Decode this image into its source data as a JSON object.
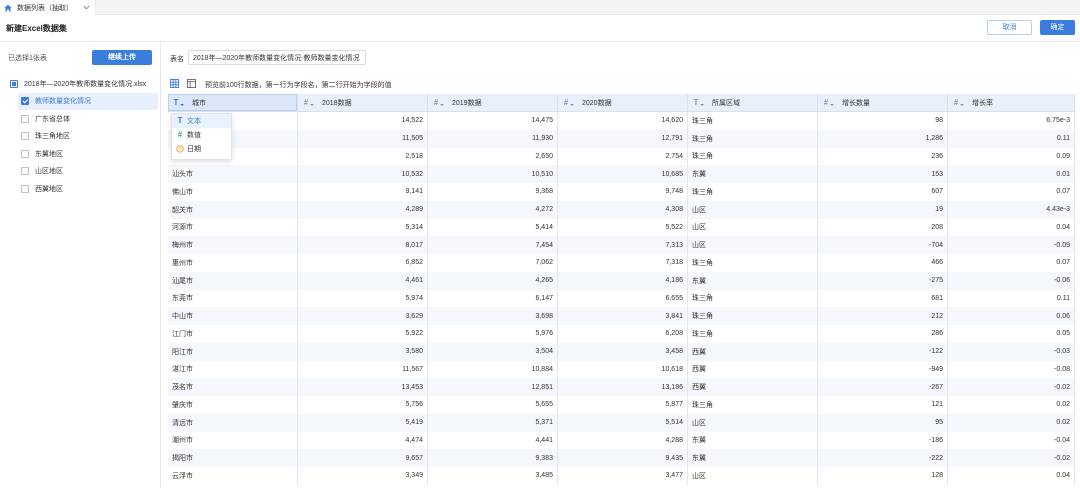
{
  "tab": {
    "label": "数据列表（抽取）"
  },
  "header": {
    "title": "新建Excel数据集",
    "cancel_label": "取消",
    "confirm_label": "确定"
  },
  "left_panel": {
    "selected_text": "已选择1张表",
    "upload_label": "继续上传",
    "file": {
      "label": "2018年—2020年教师数量变化情况.xlsx",
      "indeterminate": true
    },
    "sheets": [
      {
        "label": "教师数量变化情况",
        "checked": true,
        "active": true
      },
      {
        "label": "广东省总体",
        "checked": false
      },
      {
        "label": "珠三角地区",
        "checked": false
      },
      {
        "label": "东翼地区",
        "checked": false
      },
      {
        "label": "山区地区",
        "checked": false
      },
      {
        "label": "西翼地区",
        "checked": false
      }
    ]
  },
  "table_name": {
    "label": "表名",
    "value": "2018年—2020年教师数量变化情况-教师数量变化情况"
  },
  "preview": {
    "hint": "预览前100行数据，第一行为字段名，第二行开始为字段的值"
  },
  "table": {
    "columns": [
      {
        "icon": "text-type-icon",
        "glyph": "T",
        "label": "城市",
        "selected": true
      },
      {
        "icon": "number-type-icon",
        "glyph": "#",
        "label": "2018数据"
      },
      {
        "icon": "number-type-icon",
        "glyph": "#",
        "label": "2019数据"
      },
      {
        "icon": "number-type-icon",
        "glyph": "#",
        "label": "2020数据"
      },
      {
        "icon": "text-type-icon",
        "glyph": "T",
        "label": "所属区域"
      },
      {
        "icon": "number-type-icon",
        "glyph": "#",
        "label": "增长数量"
      },
      {
        "icon": "number-type-icon",
        "glyph": "#",
        "label": "增长率"
      }
    ],
    "rows": [
      [
        "",
        "14,522",
        "14,475",
        "14,620",
        "珠三角",
        "98",
        "6.75e-3"
      ],
      [
        "",
        "11,505",
        "11,930",
        "12,791",
        "珠三角",
        "1,286",
        "0.11"
      ],
      [
        "",
        "2,518",
        "2,650",
        "2,754",
        "珠三角",
        "236",
        "0.09"
      ],
      [
        "汕头市",
        "10,532",
        "10,510",
        "10,685",
        "东翼",
        "153",
        "0.01"
      ],
      [
        "佛山市",
        "9,141",
        "9,368",
        "9,748",
        "珠三角",
        "607",
        "0.07"
      ],
      [
        "韶关市",
        "4,289",
        "4,272",
        "4,308",
        "山区",
        "19",
        "4.43e-3"
      ],
      [
        "河源市",
        "5,314",
        "5,414",
        "5,522",
        "山区",
        "208",
        "0.04"
      ],
      [
        "梅州市",
        "8,017",
        "7,454",
        "7,313",
        "山区",
        "-704",
        "-0.09"
      ],
      [
        "惠州市",
        "6,852",
        "7,062",
        "7,318",
        "珠三角",
        "466",
        "0.07"
      ],
      [
        "汕尾市",
        "4,461",
        "4,265",
        "4,186",
        "东翼",
        "-275",
        "-0.06"
      ],
      [
        "东莞市",
        "5,974",
        "6,147",
        "6,655",
        "珠三角",
        "681",
        "0.11"
      ],
      [
        "中山市",
        "3,629",
        "3,698",
        "3,841",
        "珠三角",
        "212",
        "0.06"
      ],
      [
        "江门市",
        "5,922",
        "5,976",
        "6,208",
        "珠三角",
        "286",
        "0.05"
      ],
      [
        "阳江市",
        "3,580",
        "3,504",
        "3,458",
        "西翼",
        "-122",
        "-0.03"
      ],
      [
        "湛江市",
        "11,567",
        "10,884",
        "10,618",
        "西翼",
        "-949",
        "-0.08"
      ],
      [
        "茂名市",
        "13,453",
        "12,851",
        "13,186",
        "西翼",
        "-267",
        "-0.02"
      ],
      [
        "肇庆市",
        "5,756",
        "5,655",
        "5,877",
        "珠三角",
        "121",
        "0.02"
      ],
      [
        "清远市",
        "5,419",
        "5,371",
        "5,514",
        "山区",
        "95",
        "0.02"
      ],
      [
        "潮州市",
        "4,474",
        "4,441",
        "4,288",
        "东翼",
        "-186",
        "-0.04"
      ],
      [
        "揭阳市",
        "9,657",
        "9,383",
        "9,435",
        "东翼",
        "-222",
        "-0.02"
      ],
      [
        "云浮市",
        "3,349",
        "3,485",
        "3,477",
        "山区",
        "128",
        "0.04"
      ]
    ]
  },
  "type_menu": [
    {
      "icon": "text-type-icon",
      "glyph": "T",
      "label": "文本",
      "active": true
    },
    {
      "icon": "number-type-icon",
      "glyph": "#",
      "label": "数值"
    },
    {
      "icon": "clock-icon",
      "label": "日期"
    }
  ],
  "colors": {
    "primary": "#3b7ddd",
    "header_bg": "#e9f0fa",
    "header_sel": "#dbe7f8",
    "stripe": "#f4f7fb",
    "number_icon": "#3aa38b",
    "date_icon": "#f0a232",
    "type_icon": "#7f95b5"
  }
}
